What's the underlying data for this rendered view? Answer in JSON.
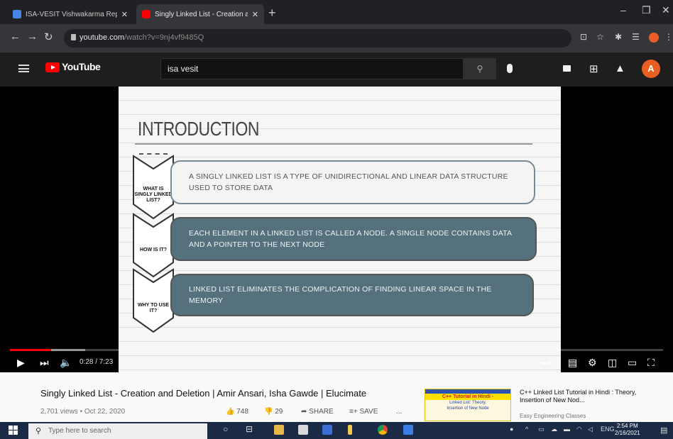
{
  "browser": {
    "tabs": [
      {
        "title": "ISA-VESIT Vishwakarma Report"
      },
      {
        "title": "Singly Linked List - Creation and"
      }
    ],
    "new_tab": "+",
    "url_host": "youtube.com",
    "url_path": "/watch?v=9nj4vf9485Q",
    "window_controls": [
      "–",
      "❐",
      "✕"
    ]
  },
  "youtube": {
    "logo_text": "YouTube",
    "search_value": "isa vesit",
    "avatar_letter": "A"
  },
  "slide": {
    "title": "INTRODUCTION",
    "sections": [
      {
        "label": "WHAT IS SINGLY LINKED LIST?",
        "text": "A singly linked list is a type of unidirectional and linear data structure used to store data"
      },
      {
        "label": "HOW IS IT?",
        "text": "Each element in a linked list is called a node. A single node contains data and a pointer to the next node"
      },
      {
        "label": "WHY TO USE IT?",
        "text": "Linked list eliminates the complication of finding linear space in the memory"
      }
    ]
  },
  "player": {
    "time": "0:28 / 7:23",
    "progress_fraction": 0.063,
    "buffered_fraction": 0.115
  },
  "video_info": {
    "title": "Singly Linked List - Creation and Deletion | Amir Ansari, Isha Gawde | Elucimate",
    "meta": "2,701 views • Oct 22, 2020",
    "likes": "748",
    "dislikes": "29",
    "share": "SHARE",
    "save": "SAVE",
    "more": "..."
  },
  "recommendation": {
    "title": "C++ Linked List Tutorial in Hindi : Theory, Insertion of New Nod...",
    "channel": "Easy Engineering Classes",
    "thumb_line1": "C++ Tutorial in Hindi -",
    "thumb_line2": "Linked List: Theory,",
    "thumb_line3": "Insertion of New Node"
  },
  "taskbar": {
    "search_placeholder": "Type here to search",
    "time": "2:54 PM",
    "date": "2/16/2021",
    "lang": "ENG"
  }
}
